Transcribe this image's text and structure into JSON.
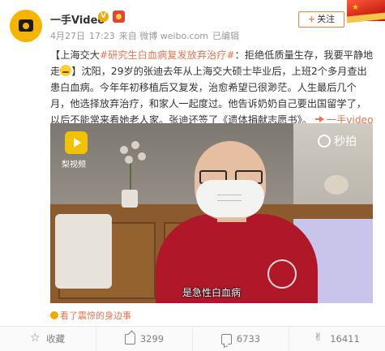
{
  "author": {
    "name": "一手Video",
    "verified_badge": "V",
    "avatar_color": "#f6b400"
  },
  "meta": {
    "date": "4月27日",
    "time": "17:23",
    "source": "来自 微博 weibo.com",
    "edited": "已编辑"
  },
  "follow_button": {
    "plus": "+",
    "label": "关注"
  },
  "post": {
    "part1": "【上海交大",
    "hashtag": "#研究生白血病复发放弃治疗#",
    "part2": "：拒绝低质量生存，我要平静地走",
    "part3": "】沈阳，29岁的张迪去年从上海交大硕士毕业后，上班2个多月查出患白血病。今年年初移植后又复发，治愈希望已很渺茫。人生最后几个月，他选择放弃治疗，和家人一起度过。他告诉奶奶自己要出国留学了，以后不能常来看她老人家。张迪还签了《遗体捐献志愿书》。",
    "video_link": "一手video的秒拍视频"
  },
  "video": {
    "app_logo_text": "梨视频",
    "watermark": "秒拍",
    "subtitle": "是急性白血病"
  },
  "story_link": "看了震惊的身边事",
  "actions": [
    {
      "icon": "star-icon",
      "label": "收藏"
    },
    {
      "icon": "share-icon",
      "label": "3299"
    },
    {
      "icon": "comment-icon",
      "label": "6733"
    },
    {
      "icon": "like-icon",
      "label": "16411"
    }
  ],
  "colors": {
    "accent": "#eb7350",
    "follow_border": "#f77c3d",
    "muted": "#999999"
  }
}
